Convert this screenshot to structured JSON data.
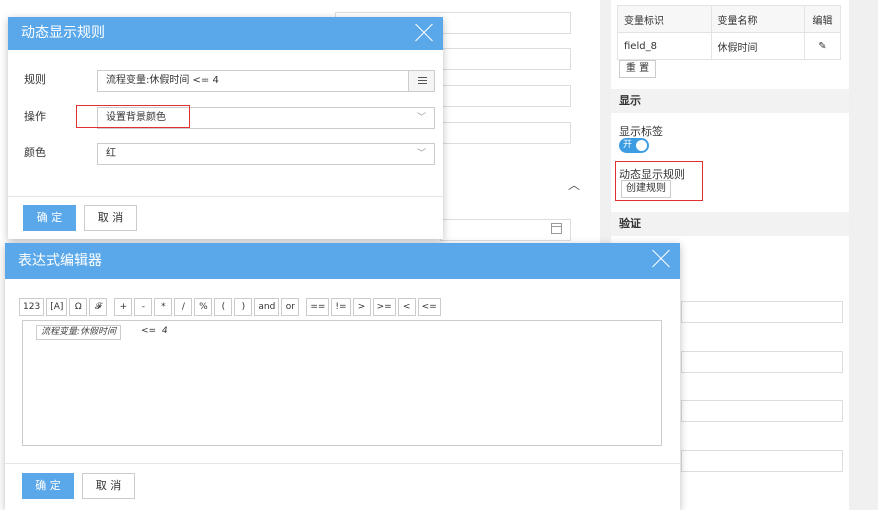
{
  "rule_dialog": {
    "title": "动态显示规则",
    "rule_label": "规则",
    "rule_value": "流程变量:休假时间 <= 4",
    "action_label": "操作",
    "action_value": "设置背景颜色",
    "color_label": "颜色",
    "color_value": "红",
    "ok_label": "确 定",
    "cancel_label": "取 消"
  },
  "expr_dialog": {
    "title": "表达式编辑器",
    "toolbar": [
      "123",
      "[A]",
      "Ω",
      "𝓕",
      "+",
      "-",
      "*",
      "/",
      "%",
      "(",
      ")",
      "and",
      "or",
      "==",
      "!=",
      ">",
      ">=",
      "<",
      "<="
    ],
    "expr_variable": "流程变量:休假时间",
    "expr_operator": "<=",
    "expr_value": "4",
    "ok_label": "确 定",
    "cancel_label": "取 消"
  },
  "right_panel": {
    "table_headers": [
      "变量标识",
      "变量名称",
      "编辑"
    ],
    "table_rows": [
      {
        "id": "field_8",
        "name": "休假时间"
      }
    ],
    "reset_label": "重 置",
    "display_section": "显示",
    "show_label_text": "显示标签",
    "toggle_text": "开",
    "dynamic_rule_text": "动态显示规则",
    "create_rule_button": "创建规则",
    "validate_section": "验证"
  },
  "colors": {
    "accent": "#5aa8ea",
    "highlight": "#e03030",
    "toggle": "#3d9de3"
  }
}
